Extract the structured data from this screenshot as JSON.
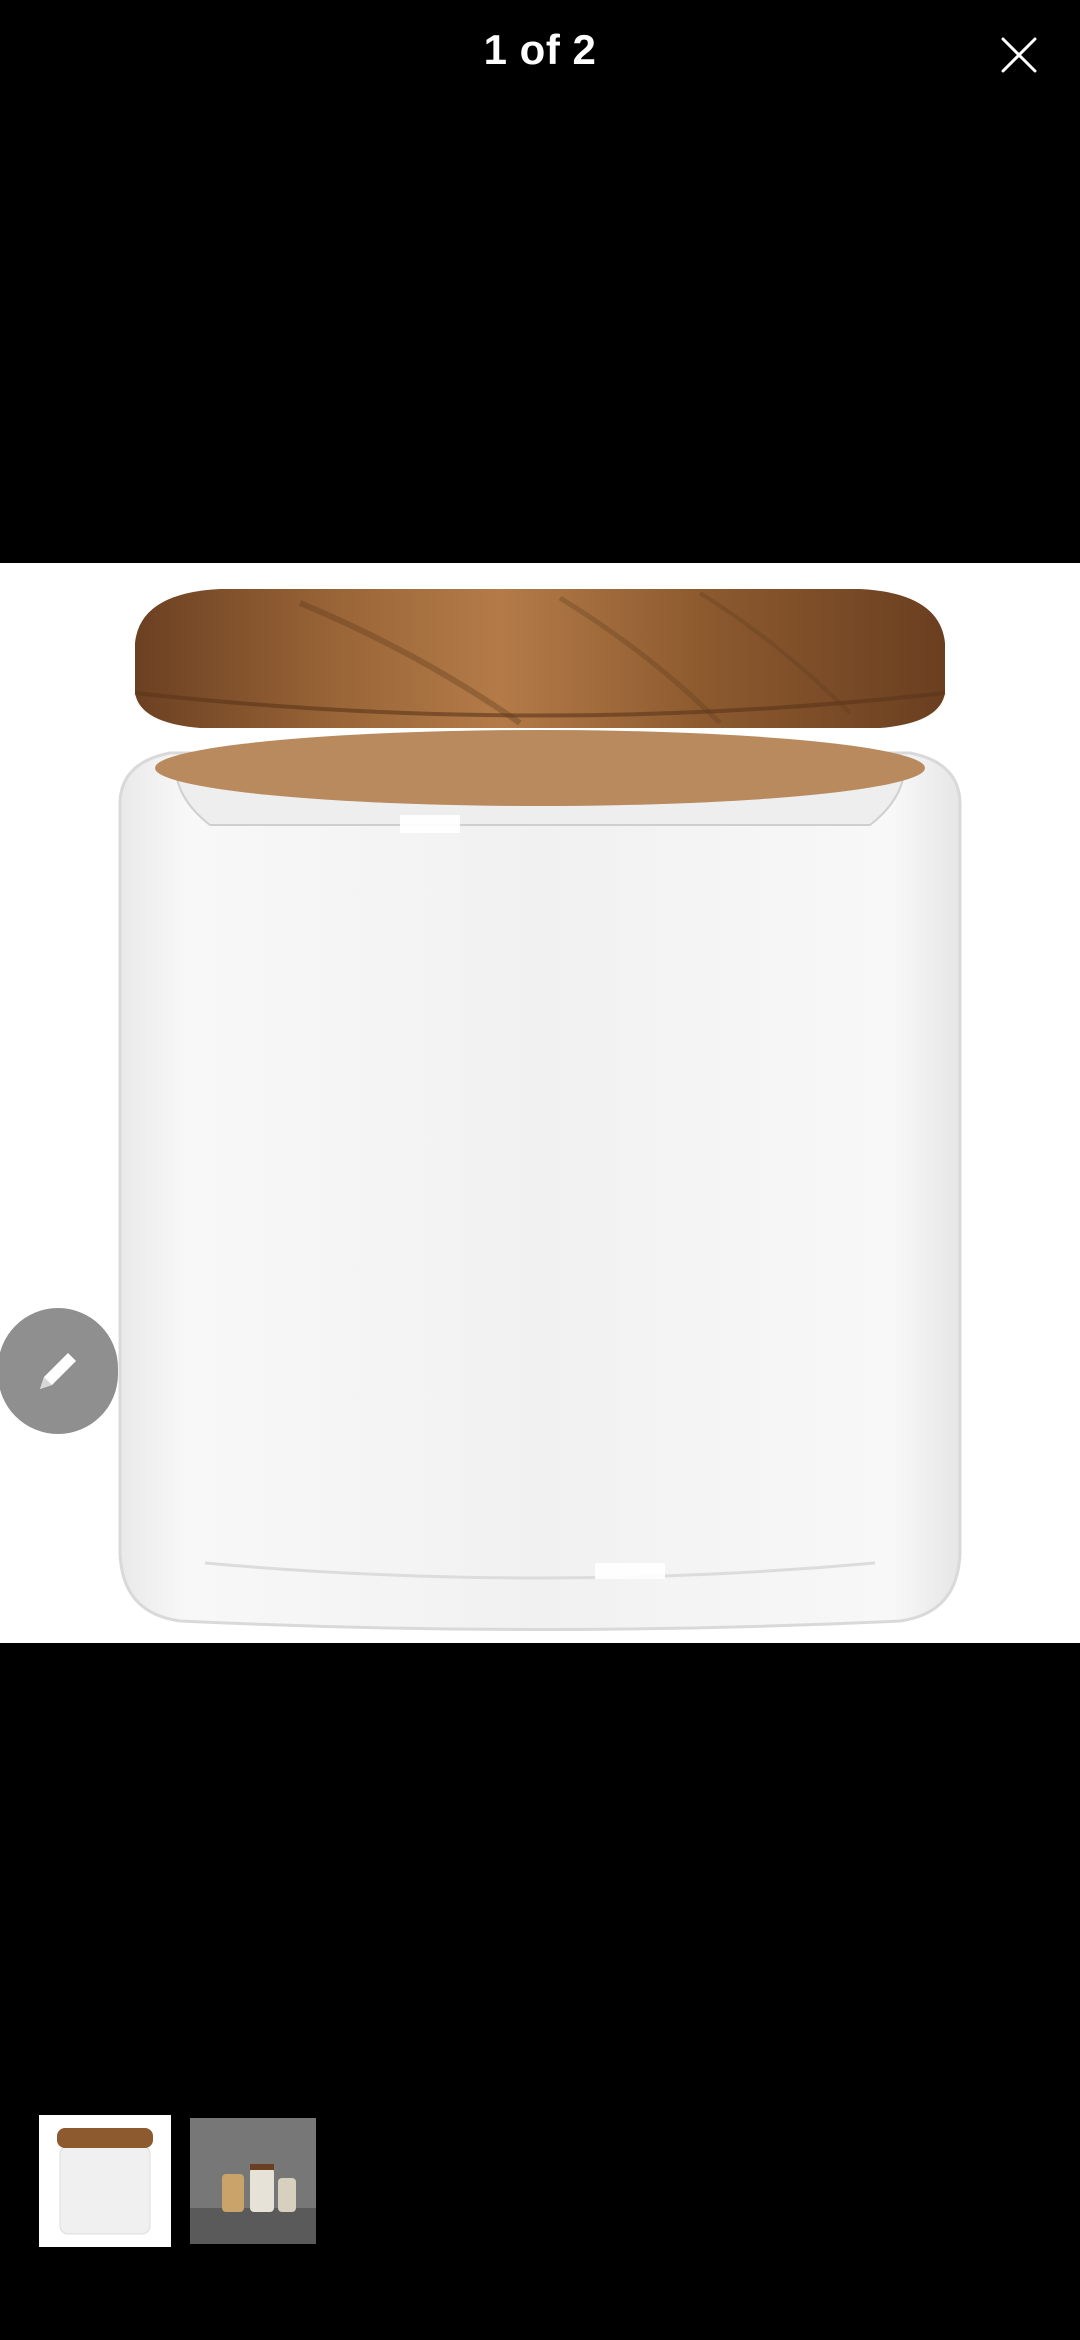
{
  "viewer": {
    "counter": "1 of 2",
    "close_icon": "close-icon",
    "edit_icon": "pencil-icon",
    "selected_index": 1,
    "total_images": 2
  },
  "images": [
    {
      "name": "glass-jar-with-wooden-lid"
    },
    {
      "name": "jars-on-kitchen-shelf"
    }
  ],
  "colors": {
    "background": "#000000",
    "wood": "#8a5a30",
    "edit_button": "#8f8f8f"
  }
}
